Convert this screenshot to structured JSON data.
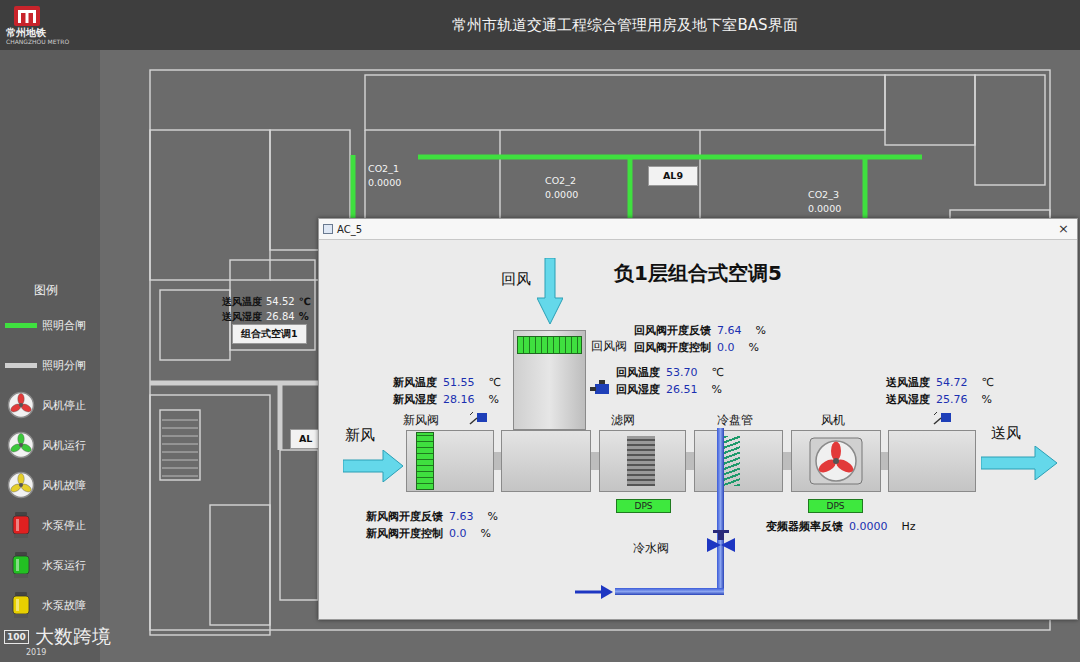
{
  "header": {
    "logo_text": "常州地铁",
    "logo_sub": "CHANGZHOU METRO",
    "title": "常州市轨道交通工程综合管理用房及地下室BAS界面"
  },
  "legend": {
    "title": "图例",
    "items": [
      {
        "label": "照明合闸",
        "kind": "line",
        "color": "#3fe03f"
      },
      {
        "label": "照明分闸",
        "kind": "line",
        "color": "#cfcfcf"
      },
      {
        "label": "风机停止",
        "kind": "fan",
        "color": "#e23a3a"
      },
      {
        "label": "风机运行",
        "kind": "fan",
        "color": "#3cc83c"
      },
      {
        "label": "风机故障",
        "kind": "fan",
        "color": "#e6cf2a"
      },
      {
        "label": "水泵停止",
        "kind": "pump",
        "color": "#e02020"
      },
      {
        "label": "水泵运行",
        "kind": "pump",
        "color": "#22c022"
      },
      {
        "label": "水泵故障",
        "kind": "pump",
        "color": "#e8d000"
      }
    ]
  },
  "floor_plan": {
    "lighting_circuits": [
      {
        "on": true
      },
      {
        "on": true
      },
      {
        "on": true
      },
      {
        "on": true
      },
      {
        "on": false
      },
      {
        "on": false
      }
    ],
    "sensors": [
      {
        "label": "CO2_1",
        "value": "0.0000"
      },
      {
        "label": "CO2_2",
        "value": "0.0000"
      },
      {
        "label": "CO2_3",
        "value": "0.0000"
      }
    ],
    "buttons": [
      "AL9",
      "组合式空调1",
      "AL"
    ],
    "readings": [
      {
        "label": "送风温度",
        "value": "54.52",
        "unit": "℃"
      },
      {
        "label": "送风湿度",
        "value": "26.84",
        "unit": "%"
      }
    ]
  },
  "popup": {
    "title": "AC_5",
    "close": "×",
    "heading": "负1层组合式空调5",
    "arrows": {
      "return_air": "回风",
      "fresh_air": "新风",
      "supply_air": "送风"
    },
    "units": {
      "fresh_damper": "新风阀",
      "return_damper": "回风阀",
      "filter": "滤网",
      "coil": "冷盘管",
      "fan": "风机",
      "chilled_valve": "冷水阀"
    },
    "fresh_damper_open": true,
    "return_damper_open": true,
    "fan_running": false,
    "dps": [
      "DPS",
      "DPS"
    ],
    "readings": {
      "return_damper": [
        {
          "label": "回风阀开度反馈",
          "value": "7.64",
          "unit": "%"
        },
        {
          "label": "回风阀开度控制",
          "value": "0.0",
          "unit": "%"
        }
      ],
      "return_air": [
        {
          "label": "回风温度",
          "value": "53.70",
          "unit": "℃"
        },
        {
          "label": "回风湿度",
          "value": "26.51",
          "unit": "%"
        }
      ],
      "fresh_air": [
        {
          "label": "新风温度",
          "value": "51.55",
          "unit": "℃"
        },
        {
          "label": "新风湿度",
          "value": "28.16",
          "unit": "%"
        }
      ],
      "supply_air": [
        {
          "label": "送风温度",
          "value": "54.72",
          "unit": "℃"
        },
        {
          "label": "送风湿度",
          "value": "25.76",
          "unit": "%"
        }
      ],
      "fresh_damper": [
        {
          "label": "新风阀开度反馈",
          "value": "7.63",
          "unit": "%"
        },
        {
          "label": "新风阀开度控制",
          "value": "0.0",
          "unit": "%"
        }
      ],
      "vfd": [
        {
          "label": "变频器频率反馈",
          "value": "0.0000",
          "unit": "Hz"
        }
      ]
    }
  },
  "watermark": {
    "logo": "100",
    "text": "大数跨境",
    "date": "2019"
  }
}
